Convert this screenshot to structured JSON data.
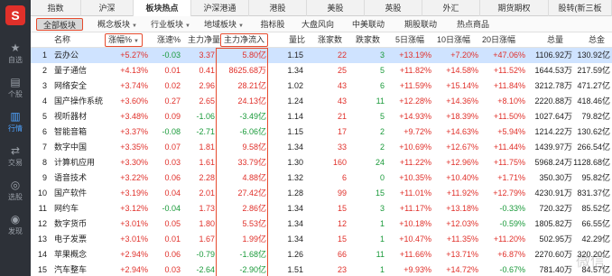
{
  "sidebar": {
    "logo": "S",
    "items": [
      {
        "label": "自选",
        "icon": "★"
      },
      {
        "label": "个股",
        "icon": "▤"
      },
      {
        "label": "行情",
        "icon": "▥"
      },
      {
        "label": "交易",
        "icon": "⇄"
      },
      {
        "label": "选股",
        "icon": "◎"
      },
      {
        "label": "发现",
        "icon": "◉"
      }
    ]
  },
  "top_tabs": [
    "指数",
    "沪深",
    "板块热点",
    "沪深港通",
    "港股",
    "美股",
    "英股",
    "外汇",
    "期货期权",
    "股转(新三板"
  ],
  "sub_tabs": [
    "全部板块",
    "概念板块",
    "行业板块",
    "地域板块",
    "指标股",
    "大盘风向",
    "中美联动",
    "期股联动",
    "热点商品"
  ],
  "columns": [
    "名称",
    "涨幅%",
    "涨速%",
    "主力净量",
    "主力净流入",
    "量比",
    "涨家数",
    "跌家数",
    "5日涨幅",
    "10日涨幅",
    "20日涨幅",
    "总量",
    "总金额"
  ],
  "rows": [
    [
      "1",
      "云办公",
      "+5.27%",
      "-0.03",
      "3.37",
      "5.80亿",
      "1.15",
      "22",
      "3",
      "+13.19%",
      "+7.20%",
      "+47.06%",
      "1106.92万",
      "130.92亿"
    ],
    [
      "2",
      "量子通信",
      "+4.13%",
      "0.01",
      "0.41",
      "8625.68万",
      "1.34",
      "25",
      "5",
      "+11.82%",
      "+14.58%",
      "+11.52%",
      "1644.53万",
      "217.59亿"
    ],
    [
      "3",
      "网络安全",
      "+3.74%",
      "0.02",
      "2.96",
      "28.21亿",
      "1.02",
      "43",
      "6",
      "+11.59%",
      "+15.14%",
      "+11.84%",
      "3212.78万",
      "471.27亿"
    ],
    [
      "4",
      "国产操作系统",
      "+3.60%",
      "0.27",
      "2.65",
      "24.13亿",
      "1.24",
      "43",
      "11",
      "+12.28%",
      "+14.36%",
      "+8.10%",
      "2220.88万",
      "418.46亿"
    ],
    [
      "5",
      "视听器材",
      "+3.48%",
      "0.09",
      "-1.06",
      "-3.49亿",
      "1.14",
      "21",
      "5",
      "+14.93%",
      "+18.39%",
      "+11.50%",
      "1027.64万",
      "79.82亿"
    ],
    [
      "6",
      "智能音箱",
      "+3.37%",
      "-0.08",
      "-2.71",
      "-6.06亿",
      "1.15",
      "17",
      "2",
      "+9.72%",
      "+14.63%",
      "+5.94%",
      "1214.22万",
      "130.62亿"
    ],
    [
      "7",
      "数字中国",
      "+3.35%",
      "0.07",
      "1.81",
      "9.58亿",
      "1.34",
      "33",
      "2",
      "+10.69%",
      "+12.67%",
      "+11.44%",
      "1439.97万",
      "266.54亿"
    ],
    [
      "8",
      "计算机应用",
      "+3.30%",
      "0.03",
      "1.61",
      "33.79亿",
      "1.30",
      "160",
      "24",
      "+11.22%",
      "+12.96%",
      "+11.75%",
      "5968.24万",
      "1128.68亿"
    ],
    [
      "9",
      "语音技术",
      "+3.22%",
      "0.06",
      "2.28",
      "4.88亿",
      "1.32",
      "6",
      "0",
      "+10.35%",
      "+10.40%",
      "+1.71%",
      "350.30万",
      "95.82亿"
    ],
    [
      "10",
      "国产软件",
      "+3.19%",
      "0.04",
      "2.01",
      "27.42亿",
      "1.28",
      "99",
      "15",
      "+11.01%",
      "+11.92%",
      "+12.79%",
      "4230.91万",
      "831.37亿"
    ],
    [
      "11",
      "网约车",
      "+3.12%",
      "-0.04",
      "1.73",
      "2.86亿",
      "1.34",
      "15",
      "3",
      "+11.17%",
      "+13.18%",
      "-0.33%",
      "720.32万",
      "85.52亿"
    ],
    [
      "12",
      "数字货币",
      "+3.01%",
      "0.05",
      "1.80",
      "5.53亿",
      "1.34",
      "12",
      "1",
      "+10.18%",
      "+12.03%",
      "-0.59%",
      "1805.82万",
      "66.55亿"
    ],
    [
      "13",
      "电子发票",
      "+3.01%",
      "0.01",
      "1.67",
      "1.99亿",
      "1.34",
      "15",
      "1",
      "+10.47%",
      "+11.35%",
      "+11.20%",
      "502.95万",
      "42.29亿"
    ],
    [
      "14",
      "苹果概念",
      "+2.94%",
      "0.06",
      "-0.79",
      "-1.68亿",
      "1.26",
      "66",
      "11",
      "+11.66%",
      "+13.71%",
      "+6.87%",
      "2270.60万",
      "320.20亿"
    ],
    [
      "15",
      "汽车整车",
      "+2.94%",
      "0.03",
      "-2.64",
      "-2.90亿",
      "1.51",
      "23",
      "1",
      "+9.93%",
      "+14.72%",
      "-0.67%",
      "781.40万",
      "84.57亿"
    ]
  ],
  "colors": {
    "up": "#e0302a",
    "down": "#1a9a3a",
    "highlight_box": "#e64b2e",
    "selected_row": "#cfe3ff",
    "sidebar_bg": "#2d3138"
  }
}
